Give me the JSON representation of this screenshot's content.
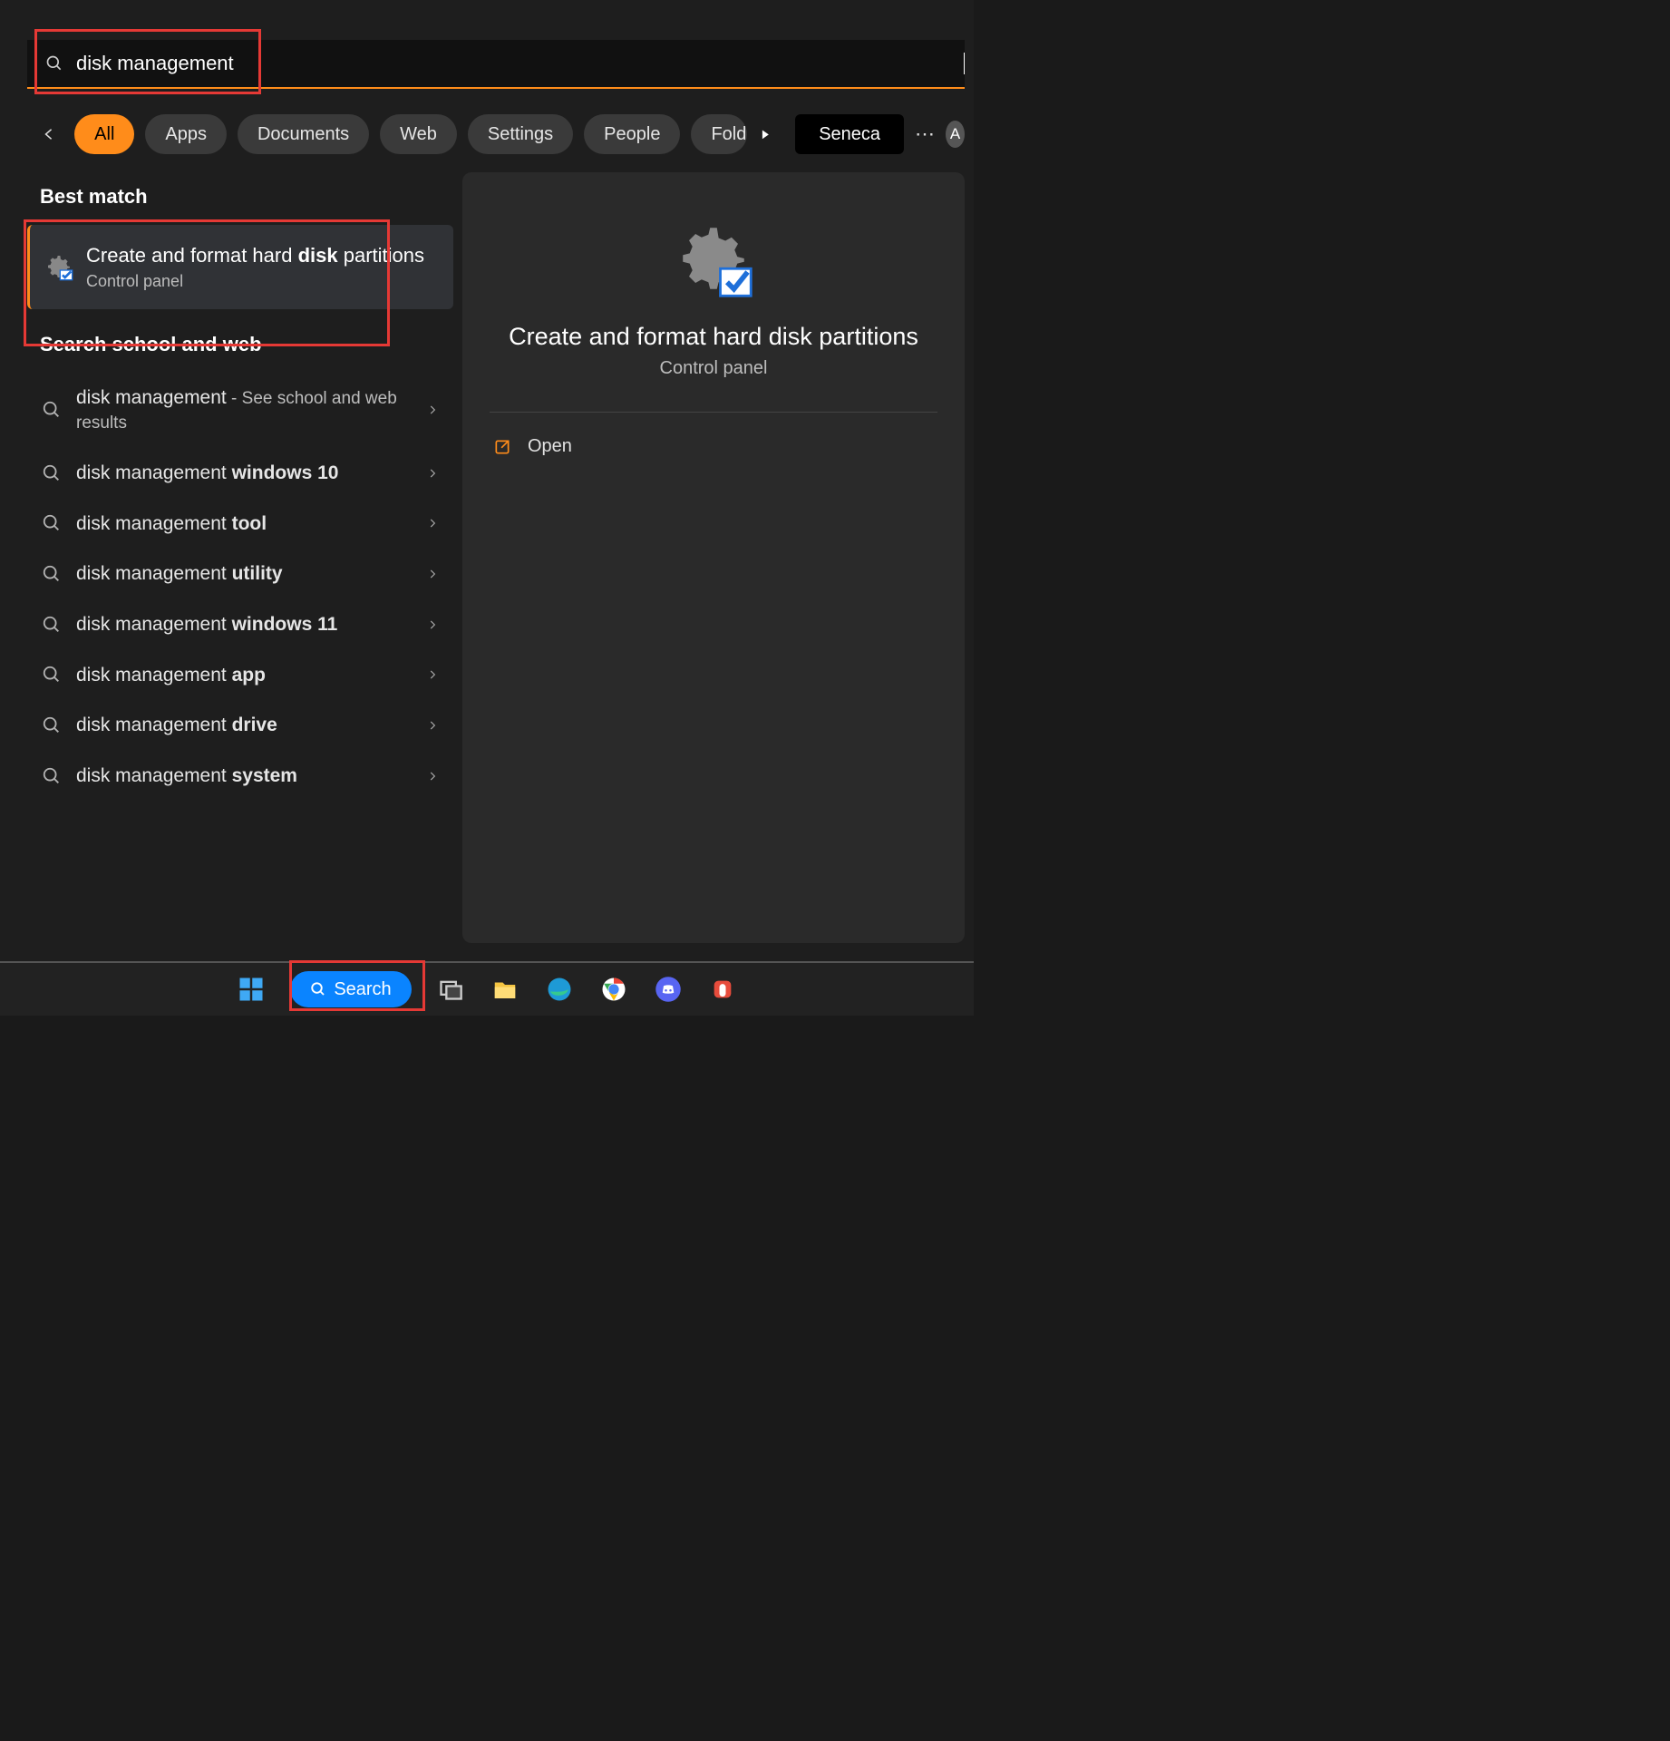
{
  "search": {
    "value": "disk management"
  },
  "tabs": {
    "items": [
      "All",
      "Apps",
      "Documents",
      "Web",
      "Settings",
      "People",
      "Folders"
    ],
    "active_index": 0
  },
  "org_button": "Seneca",
  "avatar_letter": "A",
  "left": {
    "best_match_header": "Best match",
    "best_match": {
      "title_pre": "Create and format hard ",
      "title_bold1": "disk",
      "title_mid": " partitions",
      "subtitle": "Control panel"
    },
    "web_header": "Search school and web",
    "suggestions": [
      {
        "pre": "disk management",
        "bold": "",
        "hint": " - See school and web results"
      },
      {
        "pre": "disk management ",
        "bold": "windows 10",
        "hint": ""
      },
      {
        "pre": "disk management ",
        "bold": "tool",
        "hint": ""
      },
      {
        "pre": "disk management ",
        "bold": "utility",
        "hint": ""
      },
      {
        "pre": "disk management ",
        "bold": "windows 11",
        "hint": ""
      },
      {
        "pre": "disk management ",
        "bold": "app",
        "hint": ""
      },
      {
        "pre": "disk management ",
        "bold": "drive",
        "hint": ""
      },
      {
        "pre": "disk management ",
        "bold": "system",
        "hint": ""
      }
    ]
  },
  "right": {
    "title": "Create and format hard disk partitions",
    "subtitle": "Control panel",
    "actions": [
      {
        "label": "Open"
      }
    ]
  },
  "taskbar": {
    "search_label": "Search"
  }
}
